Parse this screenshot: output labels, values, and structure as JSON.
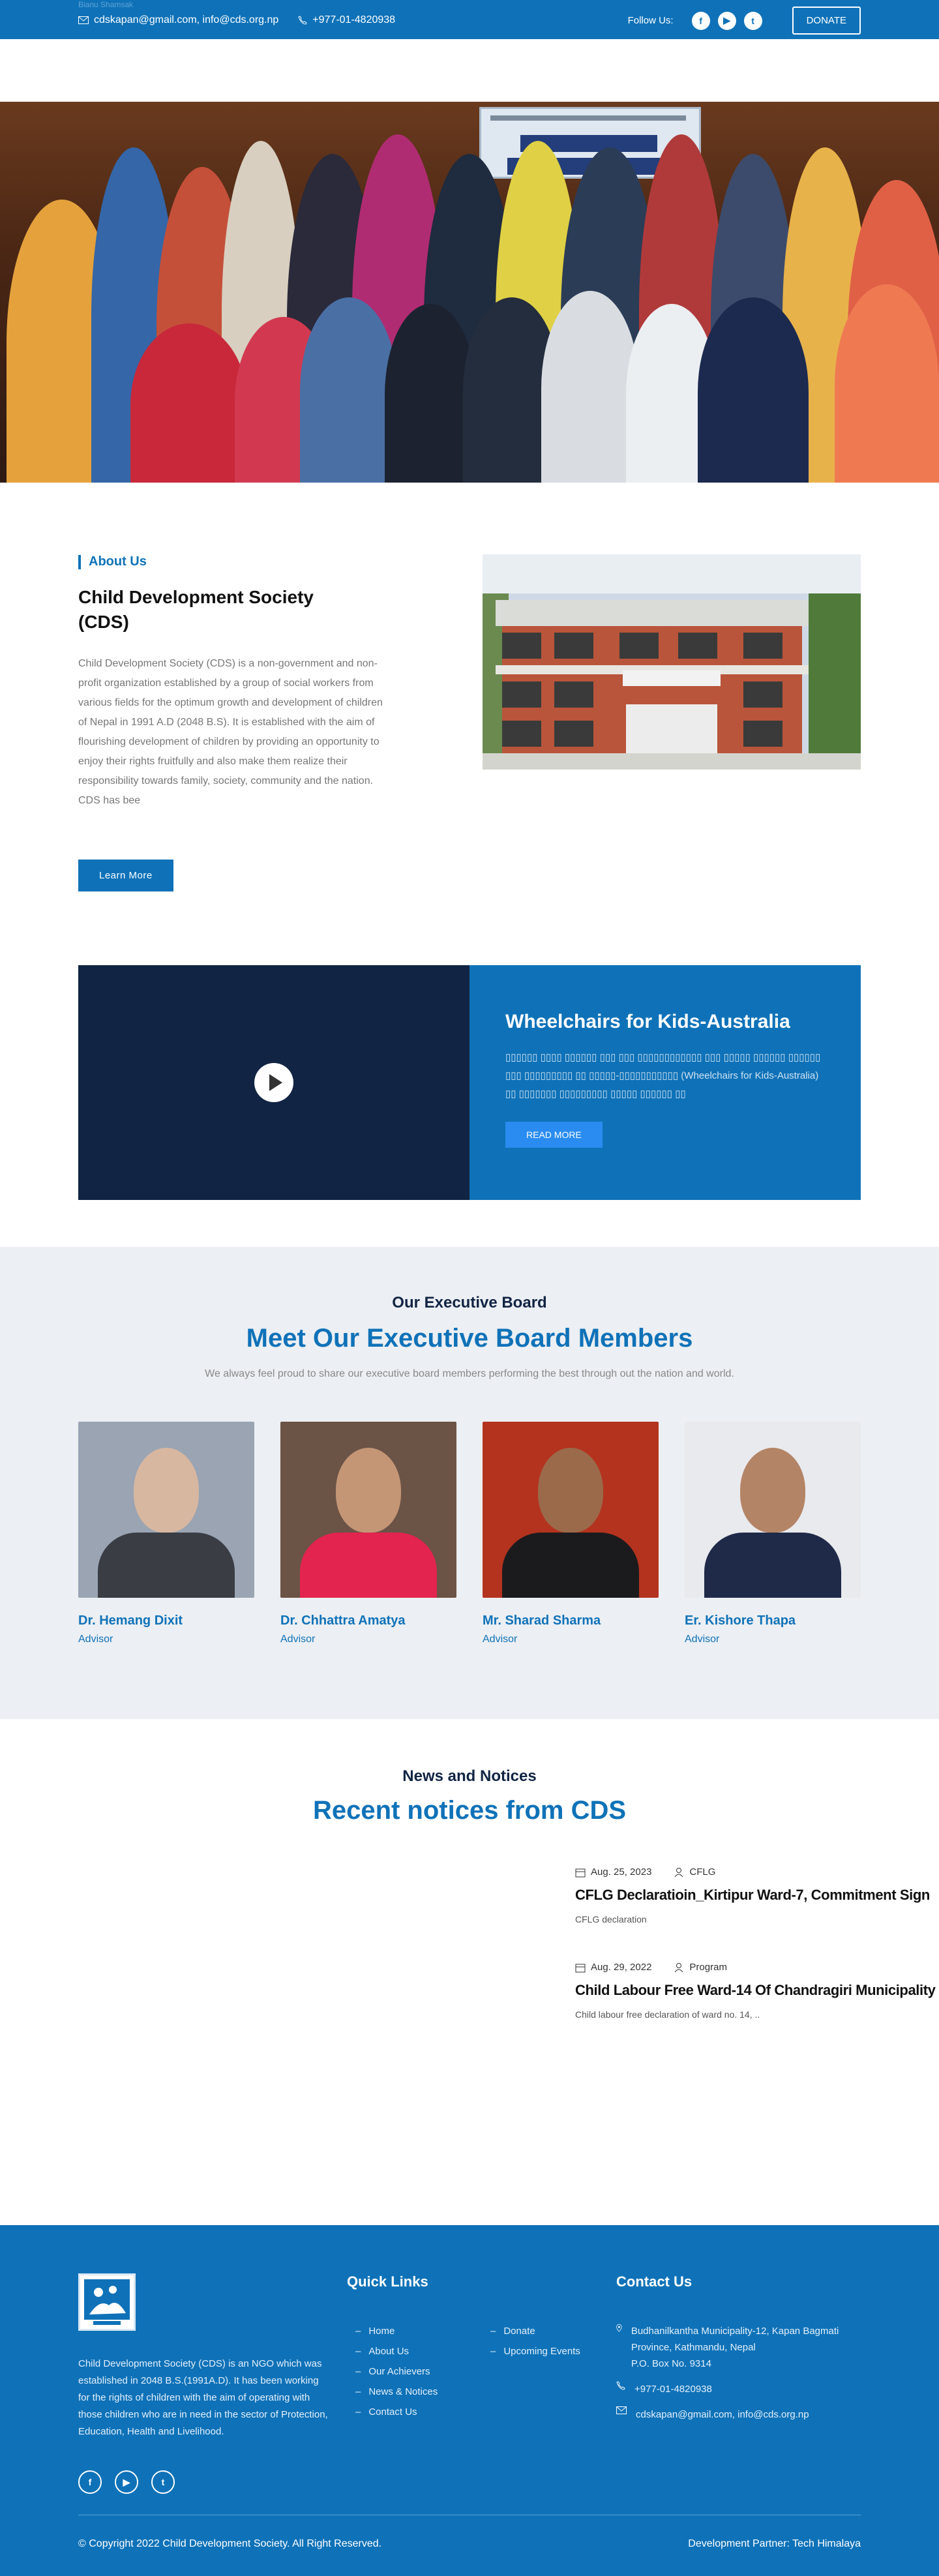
{
  "topbar": {
    "ghost_text": "Bianu Shamsak",
    "email": "cdskapan@gmail.com, info@cds.org.np",
    "phone": "+977-01-4820938",
    "follow_label": "Follow Us:",
    "donate_label": "DONATE",
    "social_icons": [
      "facebook-icon",
      "youtube-icon",
      "twitter-icon"
    ]
  },
  "about": {
    "tag": "About Us",
    "title": "Child Development Society (CDS)",
    "body": "Child Development Society (CDS) is a non-government and non-profit organization established by a group of social workers from various fields for the optimum growth and development of children of Nepal in 1991 A.D (2048 B.S). It is established with the aim of flourishing development of children by providing an opportunity to enjoy their rights fruitfully and also make them realize their responsibility towards family, society, community and the nation. CDS has bee",
    "button": "Learn More"
  },
  "video": {
    "title": "Wheelchairs for Kids-Australia",
    "body": "▯▯▯▯▯▯ ▯▯▯▯ ▯▯▯▯▯▯ ▯▯▯ ▯▯▯ ▯▯▯▯▯▯▯▯▯▯▯▯ ▯▯▯ ▯▯▯▯▯ ▯▯▯▯▯▯ ▯▯▯▯▯▯ ▯▯▯ ▯▯▯▯▯▯▯▯▯ ▯▯ ▯▯▯▯▯-▯▯▯▯▯▯▯▯▯▯▯ (Wheelchairs for Kids-Australia) ▯▯ ▯▯▯▯▯▯▯ ▯▯▯▯▯▯▯▯▯ ▯▯▯▯▯ ▯▯▯▯▯▯ ▯▯",
    "button": "READ MORE"
  },
  "board": {
    "subtitle": "Our Executive Board",
    "title": "Meet Our Executive Board Members",
    "description": "We always feel proud to share our executive board members performing the best through out the nation and world.",
    "members": [
      {
        "name": "Dr. Hemang Dixit",
        "role": "Advisor"
      },
      {
        "name": "Dr. Chhattra Amatya",
        "role": "Advisor"
      },
      {
        "name": "Mr. Sharad Sharma",
        "role": "Advisor"
      },
      {
        "name": "Er. Kishore Thapa",
        "role": "Advisor"
      }
    ]
  },
  "news": {
    "subtitle": "News and Notices",
    "title": "Recent notices from CDS",
    "items": [
      {
        "date": "Aug. 25, 2023",
        "category": "CFLG",
        "title": "CFLG Declaratioin_Kirtipur Ward-7, Commitment Sign",
        "summary": "CFLG declaration"
      },
      {
        "date": "Aug. 29, 2022",
        "category": "Program",
        "title": "Child Labour Free Ward-14 Of Chandragiri Municipality",
        "summary": "Child labour free declaration of ward no. 14, .."
      }
    ]
  },
  "footer": {
    "about_text": "Child Development Society (CDS) is an NGO which was established in 2048 B.S.(1991A.D). It has been working for the rights of children with the aim of operating with those children who are in need in the sector of Protection, Education, Health and Livelihood.",
    "quick_links_title": "Quick Links",
    "links_col1": [
      "Home",
      "About Us",
      "Our Achievers",
      "News & Notices",
      "Contact Us"
    ],
    "links_col2": [
      "Donate",
      "Upcoming Events"
    ],
    "contact_title": "Contact Us",
    "address": "Budhanilkantha Municipality-12, Kapan Bagmati Province, Kathmandu, Nepal",
    "pobox": "P.O. Box No. 9314",
    "phone": "+977-01-4820938",
    "email": "cdskapan@gmail.com, info@cds.org.np",
    "copyright": "© Copyright 2022 Child Development Society. All Right Reserved.",
    "developer": "Development Partner: Tech Himalaya"
  },
  "colors": {
    "primary": "#0f72b8",
    "navy": "#112443",
    "light_bg": "#eceff3"
  }
}
